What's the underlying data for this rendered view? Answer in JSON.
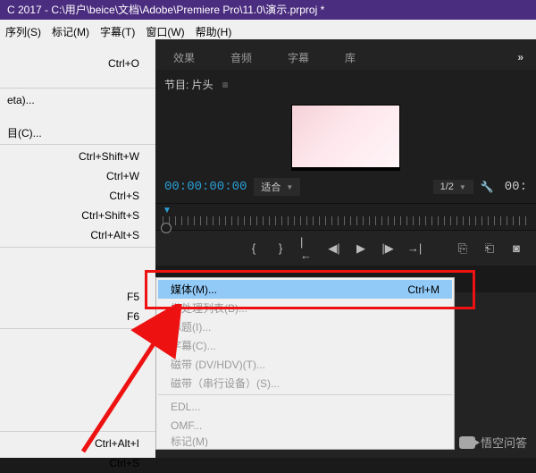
{
  "title_bar": "C 2017 - C:\\用户\\beice\\文档\\Adobe\\Premiere Pro\\11.0\\演示.prproj *",
  "menubar": [
    "序列(S)",
    "标记(M)",
    "字幕(T)",
    "窗口(W)",
    "帮助(H)"
  ],
  "file_menu": {
    "shortcuts_top": [
      "Ctrl+O"
    ],
    "items_mid": [
      "eta)...",
      "",
      "目(C)..."
    ],
    "shortcuts_block": [
      "Ctrl+Shift+W",
      "Ctrl+W",
      "Ctrl+S",
      "Ctrl+Shift+S",
      "Ctrl+Alt+S"
    ],
    "shortcuts_f": [
      "F5",
      "F6"
    ],
    "shortcuts_bottom": [
      "Ctrl+Alt+I",
      "Ctrl+S"
    ]
  },
  "tabs": [
    "效果",
    "音频",
    "字幕",
    "库"
  ],
  "tabs_more": "»",
  "project": {
    "label": "节目: 片头",
    "menu_glyph": "≡"
  },
  "controls": {
    "timecode": "00:00:00:00",
    "fit": "适合",
    "half": "1/2",
    "timecode2": "00:"
  },
  "export_menu": [
    {
      "label": "媒体(M)...",
      "shortcut": "Ctrl+M",
      "hl": true
    },
    {
      "label": "批处理列表(B)...",
      "dis": true
    },
    {
      "label": "标题(I)...",
      "dis": true
    },
    {
      "label": "字幕(C)...",
      "dis": true
    },
    {
      "label": "磁带 (DV/HDV)(T)...",
      "dis": true
    },
    {
      "label": "磁带（串行设备）(S)...",
      "dis": true
    },
    {
      "sep": true
    },
    {
      "label": "EDL...",
      "dis": true
    },
    {
      "label": "OMF...",
      "dis": true
    },
    {
      "label": "标记(M)",
      "dis": true,
      "cut": true
    }
  ],
  "watermark": "悟空问答"
}
